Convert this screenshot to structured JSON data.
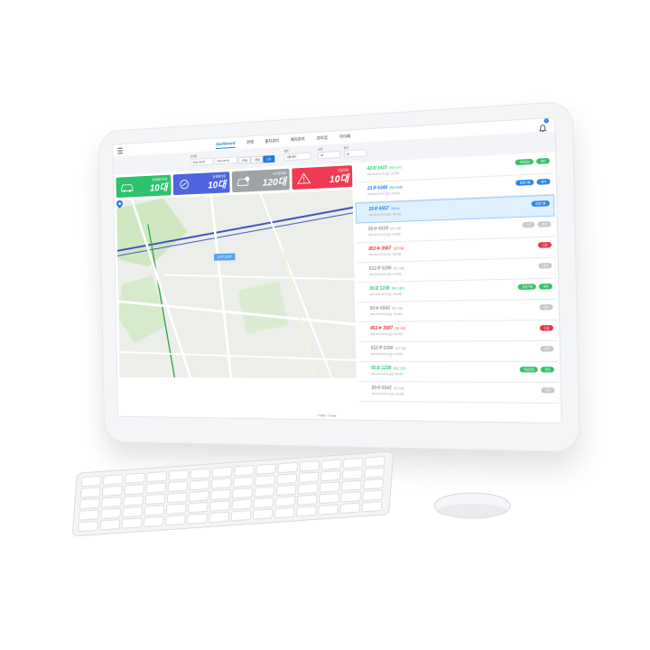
{
  "nav": {
    "tabs": [
      {
        "label": "Dashboard",
        "active": true
      },
      {
        "label": "관제"
      },
      {
        "label": "출차관리"
      },
      {
        "label": "배차관리"
      },
      {
        "label": "관리점"
      },
      {
        "label": "마이페"
      }
    ],
    "notification_count": "2"
  },
  "filter": {
    "date_label": "조회일",
    "date_from": "2021-05-03",
    "date_to": "2021-05-03",
    "quick_buttons": [
      "1개월",
      "3개월",
      "오늘"
    ],
    "selected_quick": "오늘",
    "groups": [
      {
        "label": "권역",
        "value": "서울/경기"
      },
      {
        "label": "상태",
        "value": "all"
      },
      {
        "label": "옵션",
        "value": "all"
      }
    ]
  },
  "cards": [
    {
      "label": "전체배차차량",
      "value": "10대",
      "color": "#2dc26b",
      "icon": "car-icon"
    },
    {
      "label": "운행중차량",
      "value": "10대",
      "color": "#4d66e0",
      "icon": "route-icon"
    },
    {
      "label": "대기중차량",
      "value": "120대",
      "color": "#9ea3a8",
      "icon": "parking-car-icon"
    },
    {
      "label": "긴급차량",
      "value": "10대",
      "color": "#ee3a52",
      "icon": "warning-icon"
    }
  ],
  "map": {
    "selected_tag": "15우 6557"
  },
  "list": [
    {
      "plate": "42마 1623",
      "desc": "현대 소나타",
      "sub": "2021.05.03 09:30 출발 / 반납예정",
      "status": "g",
      "buttons": [
        {
          "label": "차량정보",
          "color": "g"
        },
        {
          "label": "배차",
          "color": "g"
        }
      ]
    },
    {
      "plate": "21우 6340",
      "desc": "현대 아반떼",
      "sub": "2021.05.03 09:30 출발 / 반납예정",
      "status": "b",
      "buttons": [
        {
          "label": "운행기록",
          "color": "b"
        },
        {
          "label": "배차",
          "color": "b"
        }
      ]
    },
    {
      "plate": "15우 6557",
      "desc": "기아 K5",
      "sub": "2021.05.03 09:30 출발 / 반납예정",
      "status": "b",
      "selected": true,
      "buttons": [
        {
          "label": "운행기록",
          "color": "b"
        }
      ]
    },
    {
      "plate": "50수 6534",
      "desc": "대기 차량",
      "sub": "2021.05.03 09:30 출발 / 반납예정",
      "status": "gr",
      "buttons": [
        {
          "label": "대기",
          "color": "gr"
        },
        {
          "label": "배차",
          "color": "gr"
        }
      ]
    },
    {
      "plate": "853누 3587",
      "desc": "긴급 차량",
      "sub": "2021.05.03 09:30 출발 / 반납예정",
      "status": "r",
      "buttons": [
        {
          "label": "긴급",
          "color": "r"
        }
      ]
    },
    {
      "plate": "512주 5396",
      "desc": "대기 차량",
      "sub": "2021.05.03 09:30 출발 / 반납예정",
      "status": "gr",
      "buttons": [
        {
          "label": "대기",
          "color": "gr"
        }
      ]
    },
    {
      "plate": "55모 1238",
      "desc": "현대 그랜저",
      "sub": "2021.05.03 09:30 출발 / 반납예정",
      "status": "g",
      "buttons": [
        {
          "label": "운행기록",
          "color": "g"
        },
        {
          "label": "배차",
          "color": "g"
        }
      ]
    },
    {
      "plate": "50수 6542",
      "desc": "대기 차량",
      "sub": "2021.05.03 09:30 출발 / 반납예정",
      "status": "gr",
      "buttons": [
        {
          "label": "대기",
          "color": "gr"
        }
      ]
    },
    {
      "plate": "853누 3587",
      "desc": "긴급 차량",
      "sub": "2021.05.03 09:30 출발 / 반납예정",
      "status": "r",
      "buttons": [
        {
          "label": "긴급",
          "color": "r"
        }
      ]
    },
    {
      "plate": "512주 5396",
      "desc": "대기 차량",
      "sub": "2021.05.03 09:30 출발 / 반납예정",
      "status": "gr",
      "buttons": [
        {
          "label": "대기",
          "color": "gr"
        }
      ]
    },
    {
      "plate": "55모 1238",
      "desc": "현대 그랜저",
      "sub": "2021.05.03 09:30 출발 / 반납예정",
      "status": "g",
      "buttons": [
        {
          "label": "차량정보",
          "color": "g"
        },
        {
          "label": "배차",
          "color": "g"
        }
      ]
    },
    {
      "plate": "50수 6542",
      "desc": "대기 차량",
      "sub": "2021.05.03 09:30 출발 / 반납예정",
      "status": "gr",
      "buttons": [
        {
          "label": "대기",
          "color": "gr"
        }
      ]
    }
  ],
  "footer": {
    "copyright": "© 2021 – Carspi"
  }
}
